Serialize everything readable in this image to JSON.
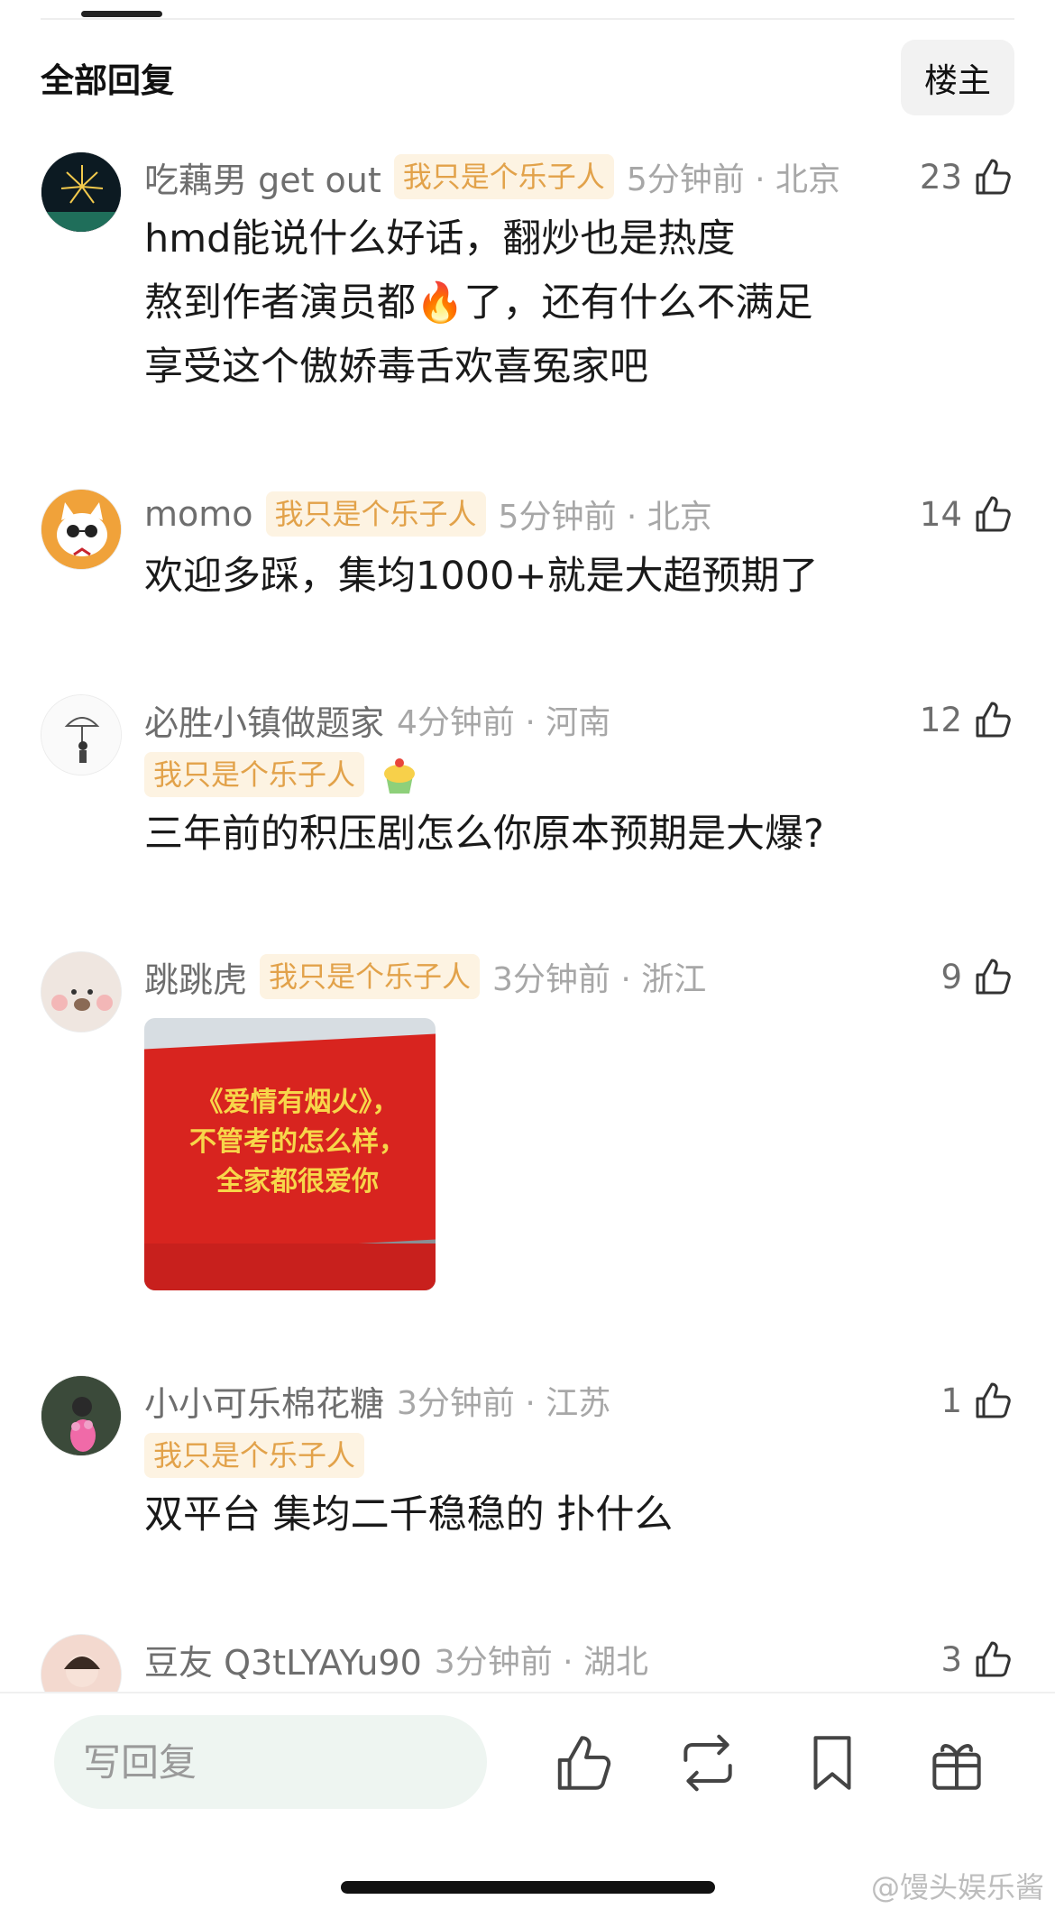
{
  "header": {
    "title": "全部回复",
    "op_label": "楼主"
  },
  "comments": [
    {
      "user": "吃藕男 get out",
      "badge": "我只是个乐子人",
      "time": "5分钟前 · 北京",
      "likes": "23",
      "lines": [
        "hmd能说什么好话，翻炒也是热度",
        "熬到作者演员都🔥了，还有什么不满足",
        "享受这个傲娇毒舌欢喜冤家吧"
      ]
    },
    {
      "user": "momo",
      "badge": "我只是个乐子人",
      "time": "5分钟前 · 北京",
      "likes": "14",
      "lines": [
        "欢迎多踩，集均1000+就是大超预期了"
      ]
    },
    {
      "user": "必胜小镇做题家",
      "badge": "我只是个乐子人",
      "time": "4分钟前 · 河南",
      "likes": "12",
      "lines": [
        "三年前的积压剧怎么你原本预期是大爆?"
      ]
    },
    {
      "user": "跳跳虎",
      "badge": "我只是个乐子人",
      "time": "3分钟前 · 浙江",
      "likes": "9",
      "banner_lines": [
        "《爱情有烟火》，",
        "不管考的怎么样，",
        "全家都很爱你"
      ]
    },
    {
      "user": "小小可乐棉花糖",
      "badge": "我只是个乐子人",
      "time": "3分钟前 · 江苏",
      "likes": "1",
      "lines": [
        "双平台 集均二千稳稳的 扑什么"
      ]
    },
    {
      "user": "豆友 Q3tLYAYu90",
      "time": "3分钟前 · 湖北",
      "likes": "3"
    }
  ],
  "reply": {
    "placeholder": "写回复"
  },
  "icons": [
    "thumbs-up-icon",
    "repost-icon",
    "bookmark-icon",
    "gift-icon"
  ],
  "watermark": "@馒头娱乐酱",
  "colors": {
    "badge_bg": "#fdf3e2",
    "badge_text": "#e2a24a",
    "banner_red": "#d8241f",
    "banner_text": "#f7d64a"
  }
}
